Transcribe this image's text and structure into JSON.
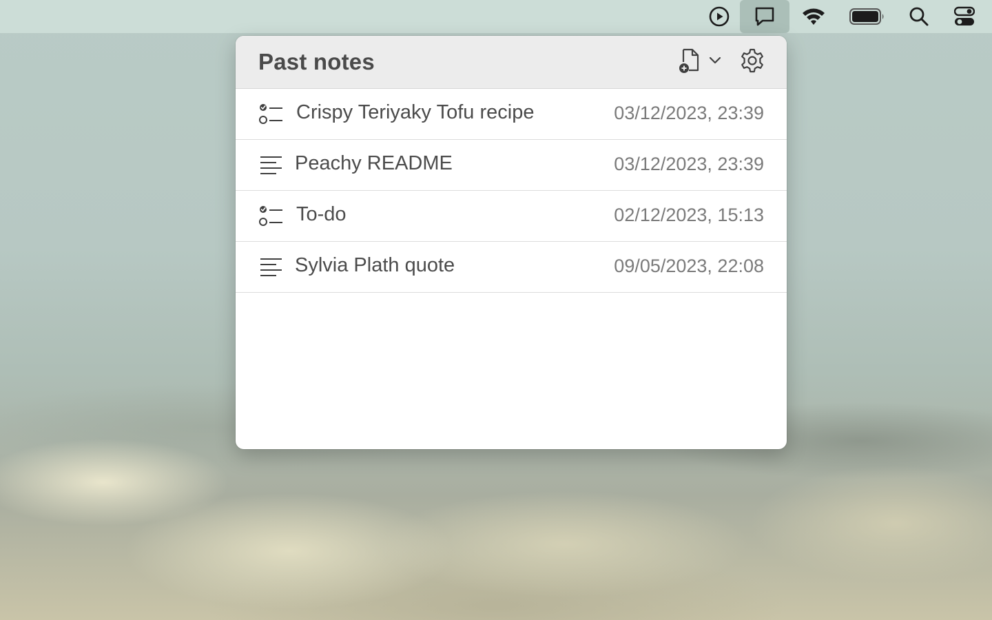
{
  "menubar": {
    "items": [
      {
        "icon": "play-circle-icon"
      },
      {
        "icon": "note-bubble-icon",
        "active": true
      },
      {
        "icon": "wifi-icon"
      },
      {
        "icon": "battery-icon"
      },
      {
        "icon": "spotlight-search-icon"
      },
      {
        "icon": "control-center-icon"
      }
    ]
  },
  "popover": {
    "title": "Past notes",
    "new_note_icon": "new-note-icon",
    "dropdown_icon": "chevron-down-icon",
    "settings_icon": "gear-icon"
  },
  "notes": [
    {
      "type": "checklist",
      "icon": "checklist-icon",
      "title": "Crispy Teriyaky Tofu recipe",
      "date": "03/12/2023, 23:39"
    },
    {
      "type": "text",
      "icon": "text-lines-icon",
      "title": "Peachy README",
      "date": "03/12/2023, 23:39"
    },
    {
      "type": "checklist",
      "icon": "checklist-icon",
      "title": "To-do",
      "date": "02/12/2023, 15:13"
    },
    {
      "type": "text",
      "icon": "text-lines-icon",
      "title": "Sylvia Plath quote",
      "date": "09/05/2023, 22:08"
    }
  ],
  "colors": {
    "menubar_bg": "#cddfd8",
    "popover_header_bg": "#ececec",
    "title_text": "#4a4a4a",
    "date_text": "#7a7a7a"
  }
}
